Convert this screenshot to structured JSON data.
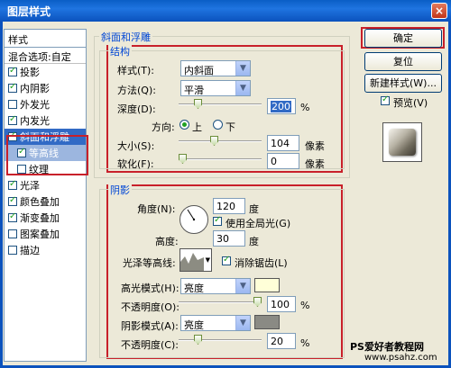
{
  "window": {
    "title": "图层样式"
  },
  "left": {
    "header": "样式",
    "blend_options": "混合选项:自定",
    "items": [
      {
        "label": "投影",
        "checked": true
      },
      {
        "label": "内阴影",
        "checked": true
      },
      {
        "label": "外发光",
        "checked": false
      },
      {
        "label": "内发光",
        "checked": true
      },
      {
        "label": "斜面和浮雕",
        "checked": true,
        "selected": true
      },
      {
        "label": "等高线",
        "checked": true,
        "sub": true
      },
      {
        "label": "纹理",
        "checked": false,
        "sub": true
      },
      {
        "label": "光泽",
        "checked": true
      },
      {
        "label": "颜色叠加",
        "checked": true
      },
      {
        "label": "渐变叠加",
        "checked": true
      },
      {
        "label": "图案叠加",
        "checked": false
      },
      {
        "label": "描边",
        "checked": false
      }
    ]
  },
  "bevel": {
    "section_title": "斜面和浮雕",
    "structure_title": "结构",
    "style_label": "样式(T):",
    "style_value": "内斜面",
    "method_label": "方法(Q):",
    "method_value": "平滑",
    "depth_label": "深度(D):",
    "depth_value": "200",
    "depth_unit": "%",
    "depth_level": 0.2,
    "direction_label": "方向:",
    "up_label": "上",
    "down_label": "下",
    "size_label": "大小(S):",
    "size_value": "104",
    "size_unit": "像素",
    "size_level": 0.42,
    "soften_label": "软化(F):",
    "soften_value": "0",
    "soften_unit": "像素",
    "soften_level": 0.0
  },
  "shading": {
    "title": "阴影",
    "angle_label": "角度(N):",
    "angle_value": "120",
    "angle_unit": "度",
    "global_light_label": "使用全局光(G)",
    "altitude_label": "高度:",
    "altitude_value": "30",
    "altitude_unit": "度",
    "gloss_label": "光泽等高线:",
    "antialias_label": "消除锯齿(L)",
    "highlight_mode_label": "高光模式(H):",
    "highlight_mode_value": "亮度",
    "highlight_color": "#ffffd8",
    "highlight_opacity_label": "不透明度(O):",
    "highlight_opacity_value": "100",
    "highlight_opacity_level": 1.0,
    "shadow_mode_label": "阴影模式(A):",
    "shadow_mode_value": "亮度",
    "shadow_color": "#8a8a84",
    "shadow_opacity_label": "不透明度(C):",
    "shadow_opacity_value": "20",
    "shadow_opacity_level": 0.2,
    "percent": "%"
  },
  "actions": {
    "ok": "确定",
    "reset": "复位",
    "new_style": "新建样式(W)...",
    "preview": "预览(V)"
  },
  "watermark": {
    "line1": "PS爱好者教程网",
    "line2": "www.psahz.com"
  },
  "colors": {
    "accent": "#316ac5",
    "highlight_red": "#c8202a",
    "group_title": "#0046d5"
  }
}
